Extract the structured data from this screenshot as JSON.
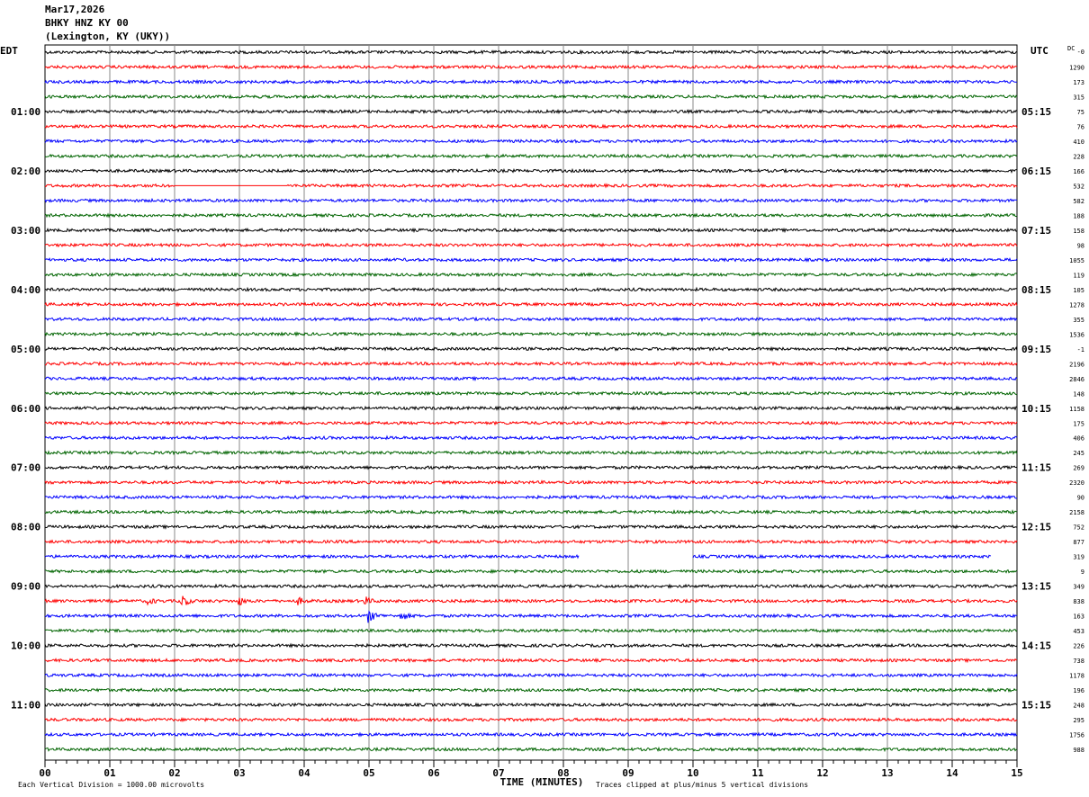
{
  "header": {
    "date": "Mar17,2026",
    "station": "BHKY HNZ KY 00",
    "location": "(Lexington, KY (UKY))"
  },
  "chart_data": {
    "type": "line",
    "title": "BHKY HNZ KY 00 helicorder",
    "left_axis_label": "EDT",
    "right_axis_label": "UTC",
    "dc_label": "DC",
    "xlabel": "TIME (MINUTES)",
    "xlim": [
      0,
      15
    ],
    "x_ticks": [
      "00",
      "01",
      "02",
      "03",
      "04",
      "05",
      "06",
      "07",
      "08",
      "09",
      "10",
      "11",
      "12",
      "13",
      "14",
      "15"
    ],
    "left_hour_labels": [
      "01:00",
      "02:00",
      "03:00",
      "04:00",
      "05:00",
      "06:00",
      "07:00",
      "08:00",
      "09:00",
      "10:00",
      "11:00"
    ],
    "right_hour_labels": [
      "05:15",
      "06:15",
      "07:15",
      "08:15",
      "09:15",
      "10:15",
      "11:15",
      "12:15",
      "13:15",
      "14:15",
      "15:15"
    ],
    "trace_colors": [
      "#000000",
      "#ff0000",
      "#0000ff",
      "#006400"
    ],
    "trace_count": 48,
    "dc_offsets": [
      "-0",
      "1290",
      "173",
      "315",
      "75",
      "76",
      "410",
      "228",
      "166",
      "532",
      "582",
      "188",
      "158",
      "98",
      "1055",
      "119",
      "105",
      "1278",
      "355",
      "1536",
      "-1",
      "2196",
      "2846",
      "148",
      "1158",
      "175",
      "406",
      "245",
      "269",
      "2320",
      "90",
      "2158",
      "752",
      "877",
      "319",
      "9",
      "349",
      "838",
      "163",
      "453",
      "226",
      "738",
      "1178",
      "196",
      "248",
      "295",
      "1756",
      "988"
    ],
    "gaps": [
      {
        "trace": 9,
        "flat_from_min": 2.0,
        "flat_to_min": 3.75
      },
      {
        "trace": 34,
        "missing_from_min": 8.25,
        "missing_to_min": 10.0
      },
      {
        "trace": 34,
        "missing_from_min": 14.6,
        "missing_to_min": 15.0
      }
    ],
    "events": [
      {
        "trace": 37,
        "minute": 2.1,
        "amplitude": 2.2
      },
      {
        "trace": 37,
        "minute": 1.6,
        "amplitude": 0.8
      },
      {
        "trace": 37,
        "minute": 3.0,
        "amplitude": 1.0
      },
      {
        "trace": 37,
        "minute": 3.9,
        "amplitude": 1.0
      },
      {
        "trace": 37,
        "minute": 4.95,
        "amplitude": 1.0
      },
      {
        "trace": 38,
        "minute": 5.0,
        "amplitude": 1.8
      },
      {
        "trace": 38,
        "minute": 5.5,
        "amplitude": 1.2
      }
    ],
    "footer_left": "Each Vertical Division = 1000.00 microvolts",
    "footer_right": "Traces clipped at plus/minus 5 vertical divisions"
  }
}
